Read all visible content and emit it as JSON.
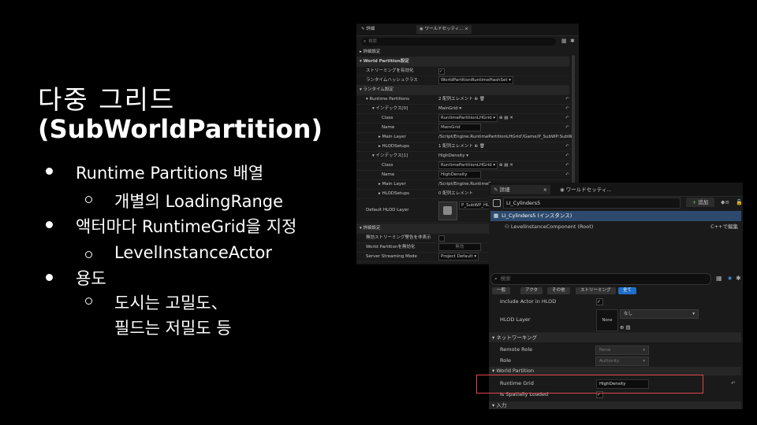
{
  "slide": {
    "title_line1": "다중 그리드",
    "title_line2": "(SubWorldPartition)",
    "bullets": [
      {
        "text": "Runtime Partitions 배열",
        "level": 1
      },
      {
        "text": "개별의 LoadingRange",
        "level": 2
      },
      {
        "text": "액터마다 RuntimeGrid을 지정",
        "level": 1
      },
      {
        "text": "LevelInstanceActor",
        "level": 2
      },
      {
        "text": "용도",
        "level": 1
      },
      {
        "text": "도시는 고밀도、",
        "level": 2
      },
      {
        "text": "필드는 저밀도 등",
        "level": 2
      }
    ]
  },
  "panel1": {
    "tab_details": "詳細",
    "tab_world": "ワールドセッティ...",
    "search_placeholder": "検索",
    "rows": {
      "general": "詳細設定",
      "wp_section": "World Partition設定",
      "streaming": "ストリーミングを有効化",
      "hash_class": "ランタイムハッシュクラス",
      "hash_class_val": "WorldPartitionRuntimeHashSet",
      "runtime_settings": "ランタイム設定",
      "runtime_partitions": "Runtime Partitions",
      "runtime_partitions_val": "2 配列エレメント",
      "index0": "インデックス[0]",
      "index0_val": "MainGrid",
      "class0": "Class",
      "class0_val": "RuntimePartitionLHGrid",
      "name0": "Name",
      "name0_val": "MainGrid",
      "mainlayer0": "Main Layer",
      "mainlayer0_val": "/Script/Engine.RuntimePartitionLHGrid'/Game/P_SubWP:SubWP",
      "hlod0": "HLODSetups",
      "hlod0_val": "1 配列エレメント",
      "index1": "インデックス[1]",
      "index1_val": "HighDensity",
      "class1": "Class",
      "class1_val": "RuntimePartitionLHGrid",
      "name1": "Name",
      "name1_val": "HighDensity",
      "mainlayer1": "Main Layer",
      "mainlayer1_val": "/Script/Engine.RuntimePar",
      "hlod1": "HLODSetups",
      "hlod1_val": "0 配列エレメント",
      "default_hlod": "Default HLOD Layer",
      "default_hlod_val": "P_SubWP_HL",
      "advanced": "詳細設定",
      "warn": "無効ストリーミング警告を非表示",
      "wp_enable": "World Partitionを無効化",
      "wp_enable_val": "無効",
      "server_mode": "Server Streaming Mode",
      "server_mode_val": "Project Default"
    }
  },
  "panel2": {
    "tab_details": "詳細",
    "tab_world": "ワールドセッティ...",
    "add_label": "追加",
    "actor_name": "LI_Cylinders5",
    "instance_row": "LI_Cylinders5 (インスタンス)",
    "component_row": "LevelInstanceComponent (Root)",
    "cpp_edit": "C++で編集",
    "search_placeholder": "検索",
    "filters": [
      "一般",
      "アクタ",
      "その他",
      "ストリーミング",
      "全て"
    ],
    "include_hlod": "Include Actor in HLOD",
    "hlod_layer": "HLOD Layer",
    "hlod_layer_none": "None",
    "hlod_layer_drop": "なし",
    "network_section": "ネットワーキング",
    "remote_role": "Remote Role",
    "remote_role_val": "None",
    "role": "Role",
    "role_val": "Authority",
    "wp_section": "World Partition",
    "runtime_grid": "Runtime Grid",
    "runtime_grid_val": "HighDensity",
    "spatially_loaded": "Is Spatially Loaded",
    "input_section": "入力"
  },
  "colors": {
    "accent_blue": "#1f6fc9",
    "highlight_red": "#e0454f",
    "add_green": "#4caf50"
  }
}
